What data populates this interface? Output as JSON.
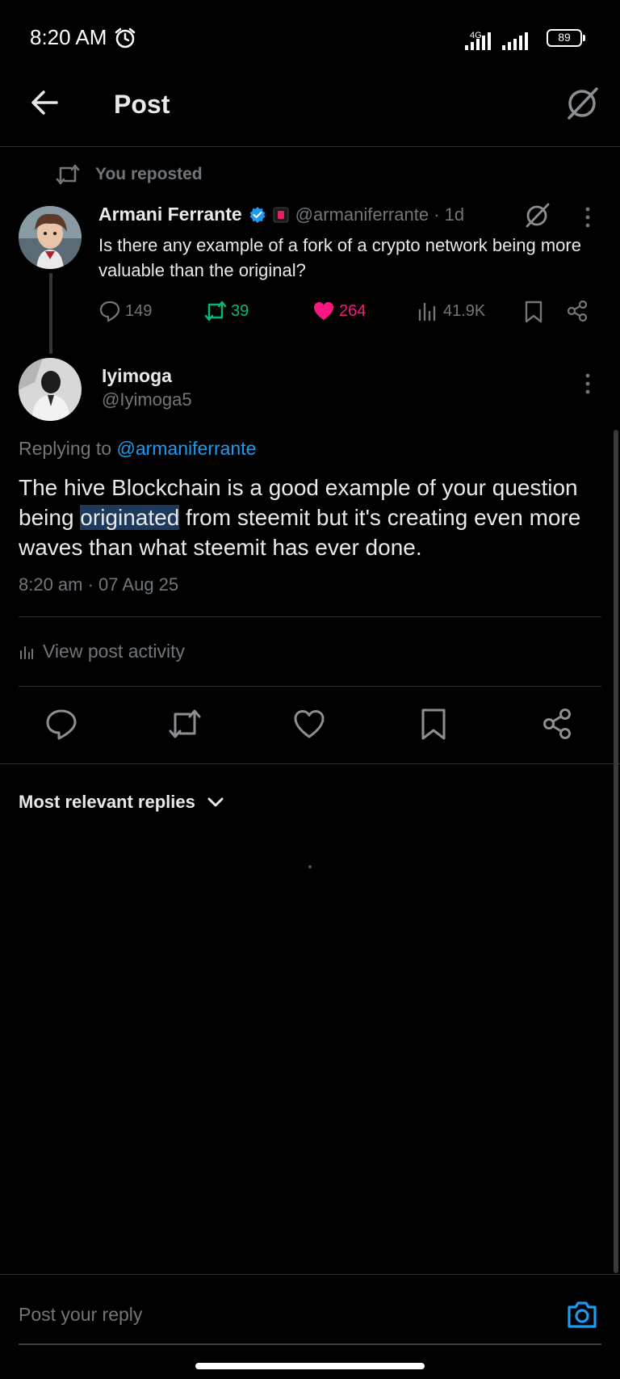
{
  "status_bar": {
    "time": "8:20 AM",
    "network": "4G",
    "battery": "89",
    "icons": [
      "alarm-icon",
      "signal-icon",
      "signal-icon",
      "battery-icon"
    ]
  },
  "header": {
    "title": "Post",
    "icons": [
      "back-arrow-icon",
      "grok-icon"
    ]
  },
  "repost_context": {
    "label": "You reposted",
    "icon": "repost-icon"
  },
  "original_post": {
    "author_name": "Armani Ferrante",
    "handle_time": "@armaniferrante · 1d",
    "text": "Is there any example of a fork of a crypto network being more valuable than the original?",
    "badges": [
      "verified-badge-icon",
      "affiliate-badge-icon"
    ],
    "stats": {
      "replies": "149",
      "reposts": "39",
      "likes": "264",
      "views": "41.9K"
    },
    "colors": {
      "repost_active": "#00ba7c",
      "like_active": "#f91880"
    }
  },
  "reply_post": {
    "author_name": "Iyimoga",
    "handle": "@Iyimoga5",
    "replying_prefix": "Replying to",
    "replying_to": "@armaniferrante",
    "text_before": "The hive Blockchain is a good example of your question being ",
    "text_highlight": "originated",
    "text_after": " from steemit but it's creating even more waves than what steemit has ever done.",
    "timestamp": "8:20 am · 07 Aug 25",
    "activity_label": "View post activity"
  },
  "action_bar": {
    "icons": [
      "reply-icon",
      "repost-icon",
      "like-icon",
      "bookmark-icon",
      "share-icon"
    ]
  },
  "replies_section": {
    "sort_label": "Most relevant replies"
  },
  "composer": {
    "placeholder": "Post your reply",
    "icon": "camera-icon"
  },
  "theme": {
    "accent": "#1d9bf0",
    "muted": "#71767b",
    "divider": "#2f3336"
  }
}
